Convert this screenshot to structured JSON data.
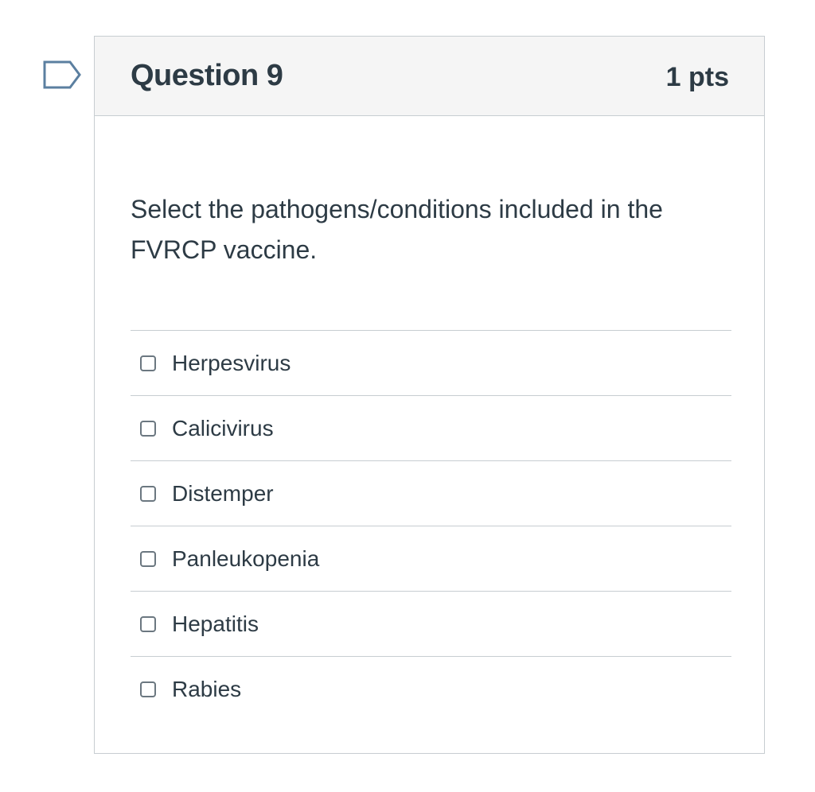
{
  "question": {
    "title": "Question 9",
    "points": "1 pts",
    "text": "Select the pathogens/conditions included in the FVRCP vaccine.",
    "flag_icon": "flag-question-icon",
    "answers": [
      {
        "label": "Herpesvirus",
        "checked": false
      },
      {
        "label": "Calicivirus",
        "checked": false
      },
      {
        "label": "Distemper",
        "checked": false
      },
      {
        "label": "Panleukopenia",
        "checked": false
      },
      {
        "label": "Hepatitis",
        "checked": false
      },
      {
        "label": "Rabies",
        "checked": false
      }
    ]
  },
  "colors": {
    "text": "#2d3b45",
    "border": "#c7cdd1",
    "header_bg": "#f5f5f5",
    "flag_stroke": "#5b7fa0"
  }
}
